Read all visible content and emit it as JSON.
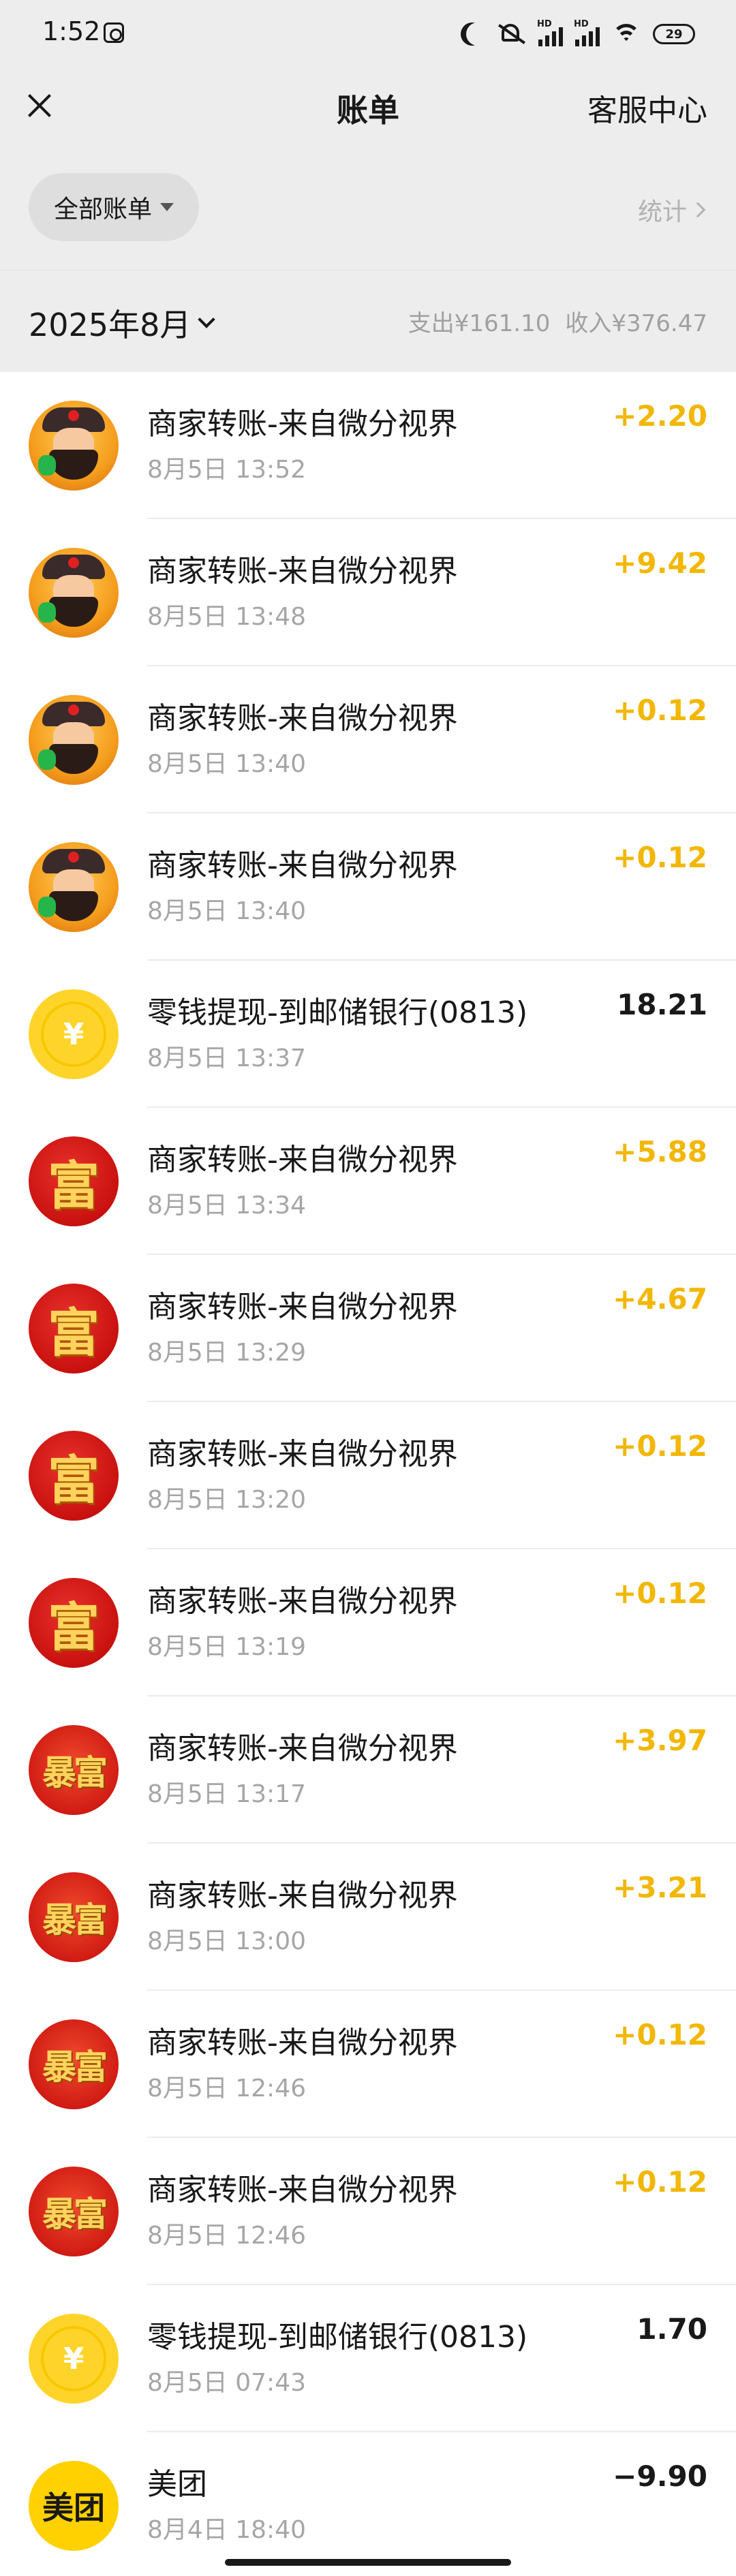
{
  "status_bar": {
    "time": "1:52",
    "battery": "29",
    "hd_label": "HD"
  },
  "nav": {
    "title": "账单",
    "right_link": "客服中心"
  },
  "filter": {
    "pill_label": "全部账单",
    "stats_label": "统计"
  },
  "month": {
    "label": "2025年8月",
    "expense": "支出¥161.10",
    "income": "收入¥376.47"
  },
  "colors": {
    "income": "#f2b705",
    "expense": "#191919",
    "background": "#ededed"
  },
  "transactions": [
    {
      "title": "商家转账-来自微分视界",
      "time": "8月5日 13:52",
      "amount": "+2.20",
      "avatar": "wealth-god"
    },
    {
      "title": "商家转账-来自微分视界",
      "time": "8月5日 13:48",
      "amount": "+9.42",
      "avatar": "wealth-god"
    },
    {
      "title": "商家转账-来自微分视界",
      "time": "8月5日 13:40",
      "amount": "+0.12",
      "avatar": "wealth-god"
    },
    {
      "title": "商家转账-来自微分视界",
      "time": "8月5日 13:40",
      "amount": "+0.12",
      "avatar": "wealth-god"
    },
    {
      "title": "零钱提现-到邮储银行(0813)",
      "time": "8月5日 13:37",
      "amount": "18.21",
      "avatar": "yuan-coin"
    },
    {
      "title": "商家转账-来自微分视界",
      "time": "8月5日 13:34",
      "amount": "+5.88",
      "avatar": "fu"
    },
    {
      "title": "商家转账-来自微分视界",
      "time": "8月5日 13:29",
      "amount": "+4.67",
      "avatar": "fu"
    },
    {
      "title": "商家转账-来自微分视界",
      "time": "8月5日 13:20",
      "amount": "+0.12",
      "avatar": "fu"
    },
    {
      "title": "商家转账-来自微分视界",
      "time": "8月5日 13:19",
      "amount": "+0.12",
      "avatar": "fu"
    },
    {
      "title": "商家转账-来自微分视界",
      "time": "8月5日 13:17",
      "amount": "+3.97",
      "avatar": "baofu"
    },
    {
      "title": "商家转账-来自微分视界",
      "time": "8月5日 13:00",
      "amount": "+3.21",
      "avatar": "baofu"
    },
    {
      "title": "商家转账-来自微分视界",
      "time": "8月5日 12:46",
      "amount": "+0.12",
      "avatar": "baofu"
    },
    {
      "title": "商家转账-来自微分视界",
      "time": "8月5日 12:46",
      "amount": "+0.12",
      "avatar": "baofu"
    },
    {
      "title": "零钱提现-到邮储银行(0813)",
      "time": "8月5日 07:43",
      "amount": "1.70",
      "avatar": "yuan-coin"
    },
    {
      "title": "美团",
      "time": "8月4日 18:40",
      "amount": "−9.90",
      "avatar": "meituan"
    }
  ],
  "avatar_text": {
    "yuan": "¥",
    "fu": "富",
    "baofu": "暴富",
    "meituan": "美团"
  }
}
